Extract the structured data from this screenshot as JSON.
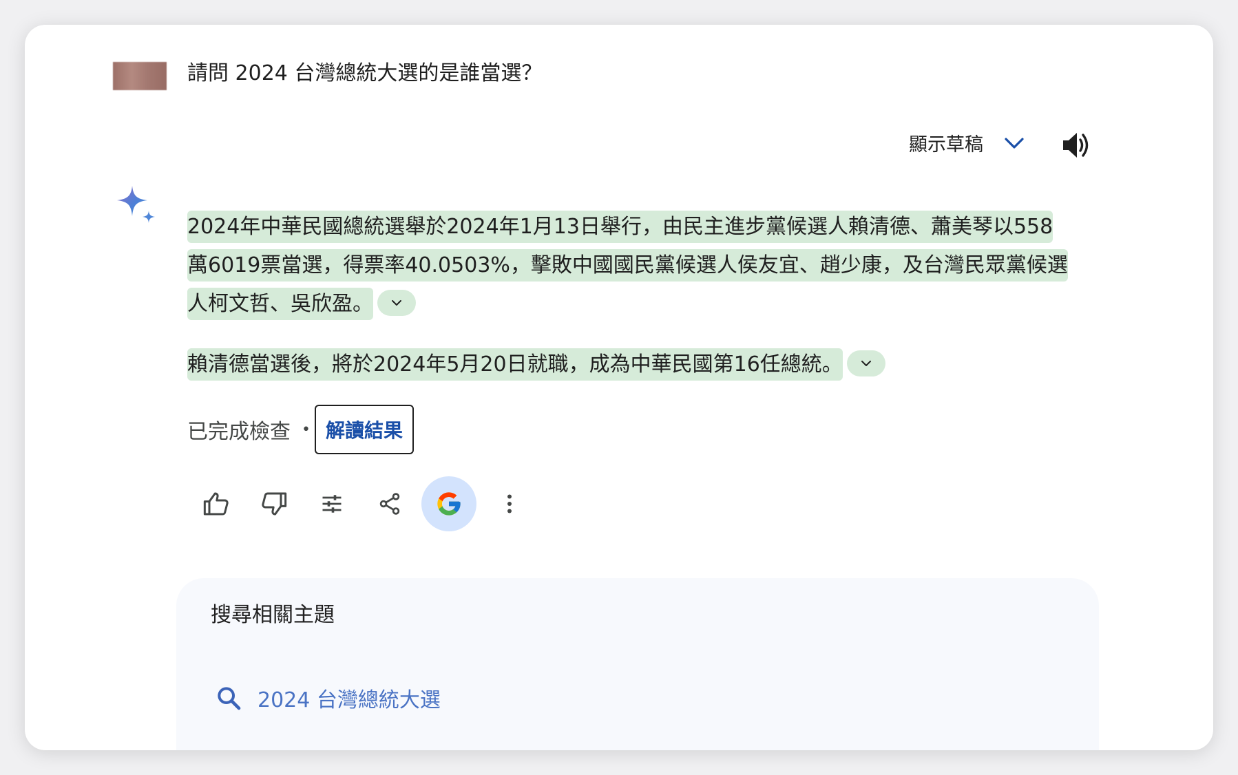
{
  "question": {
    "text": "請問 2024 台灣總統大選的是誰當選？"
  },
  "drafts": {
    "label": "顯示草稿"
  },
  "answer": {
    "paragraph1": "2024年中華民國總統選舉於2024年1月13日舉行，由民主進步黨候選人賴清德、蕭美琴以558萬6019票當選，得票率40.0503%，擊敗中國國民黨候選人侯友宜、趙少康，及台灣民眾黨候選人柯文哲、吳欣盈。",
    "paragraph2": "賴清德當選後，將於2024年5月20日就職，成為中華民國第16任總統。"
  },
  "check": {
    "status": "已完成檢查",
    "separator": "•",
    "interpret_label": "解讀結果"
  },
  "related": {
    "title": "搜尋相關主題",
    "items": [
      {
        "label": "2024 台灣總統大選"
      }
    ]
  },
  "colors": {
    "highlight": "#d6ebd9",
    "link_blue": "#1a4fa8",
    "google_button_bg": "#d3e3fd",
    "related_bg": "#f7f9fd"
  },
  "icons": {
    "speaker": "speaker-icon",
    "sparkle": "gemini-sparkle-icon",
    "thumb_up": "thumb-up-icon",
    "thumb_down": "thumb-down-icon",
    "modify": "tune-icon",
    "share": "share-icon",
    "google": "google-g-icon",
    "more": "more-vert-icon",
    "search": "search-icon"
  }
}
